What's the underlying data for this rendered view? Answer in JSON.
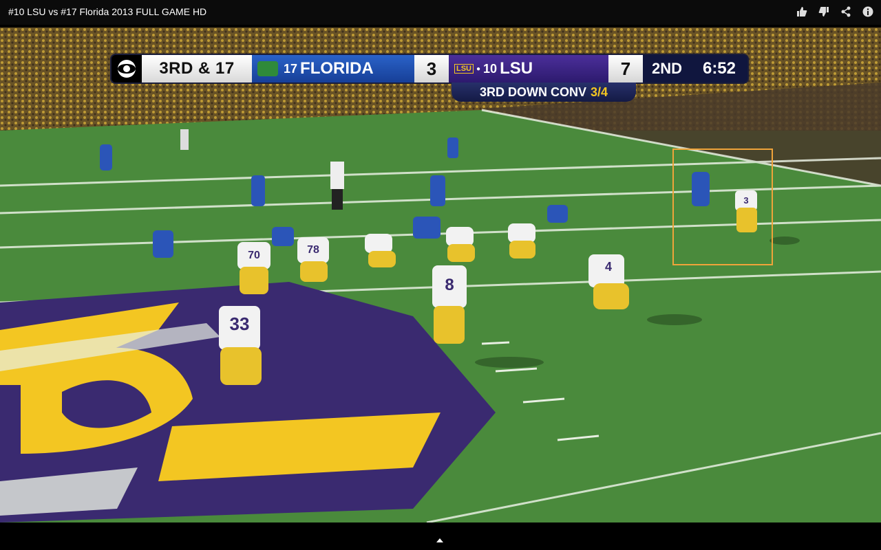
{
  "window": {
    "title": "#10 LSU vs #17 Florida 2013 FULL GAME HD",
    "icons": [
      "thumbs-up-icon",
      "thumbs-down-icon",
      "share-icon",
      "info-icon"
    ]
  },
  "scorebug": {
    "down_distance": "3RD & 17",
    "away": {
      "rank": "17",
      "name": "FLORIDA",
      "score": "3"
    },
    "home": {
      "badge": "LSU",
      "rank": "10",
      "name": "LSU",
      "score": "7"
    },
    "quarter": "2ND",
    "clock": "6:52",
    "conversion_label": "3RD DOWN CONV",
    "conversion_value": "3/4"
  },
  "players": {
    "lsu": [
      "70",
      "78",
      "8",
      "33",
      "4",
      "3"
    ]
  },
  "colors": {
    "field_green": "#4a8a3c",
    "lsu_purple": "#3a2a70",
    "lsu_gold": "#f3c622",
    "florida_blue": "#2b55b8",
    "highlight": "#f0a43a"
  }
}
